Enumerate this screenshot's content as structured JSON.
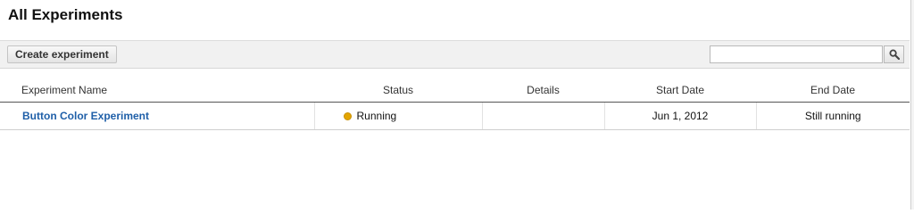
{
  "page": {
    "title": "All Experiments"
  },
  "toolbar": {
    "create_label": "Create experiment",
    "search_value": "",
    "search_icon": "search-icon"
  },
  "table": {
    "columns": [
      "Experiment Name",
      "Status",
      "Details",
      "Start Date",
      "End Date"
    ],
    "rows": [
      {
        "name": "Button Color Experiment",
        "status": "Running",
        "status_color": "#e3a500",
        "details": "",
        "start_date": "Jun 1, 2012",
        "end_date": "Still running"
      }
    ]
  },
  "colors": {
    "link": "#1f5fa8",
    "toolbar_bg": "#f1f1f1"
  }
}
